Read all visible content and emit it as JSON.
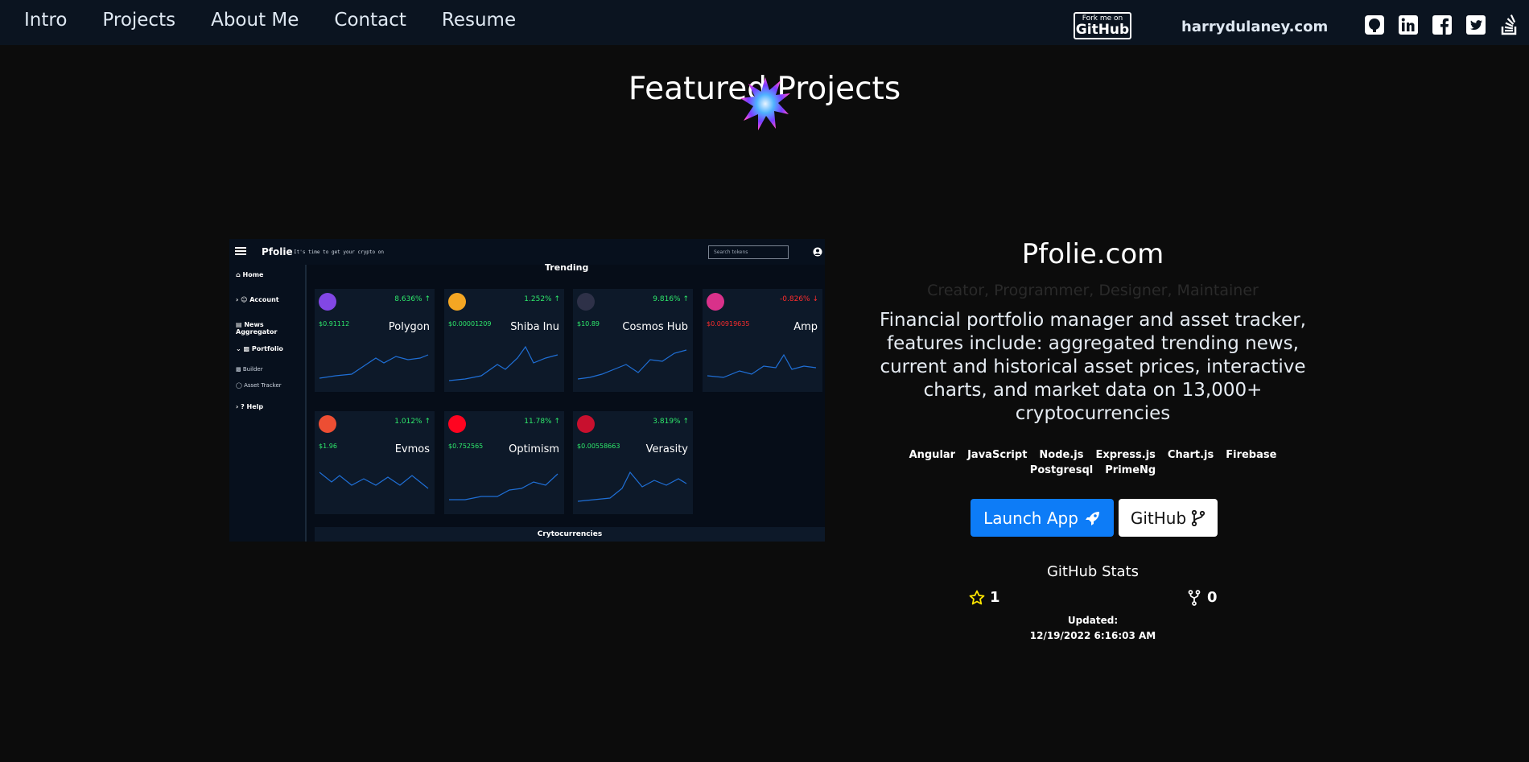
{
  "nav": {
    "links": [
      "Intro",
      "Projects",
      "About Me",
      "Contact",
      "Resume"
    ],
    "fork_small": "Fork me on",
    "fork_big": "GitHub",
    "domain": "harrydulaney.com",
    "socials": [
      "github-icon",
      "linkedin-icon",
      "facebook-icon",
      "twitter-icon",
      "stackoverflow-icon"
    ]
  },
  "page_title": "Featured Projects",
  "preview": {
    "brand": "Pfolie",
    "tagline": "It's time to get your crypto on",
    "search_placeholder": "Search tokens",
    "sidebar": {
      "home": "Home",
      "account": "Account",
      "news": "News Aggregator",
      "portfolio": "Portfolio",
      "builder": "Builder",
      "asset_tracker": "Asset Tracker",
      "help": "Help"
    },
    "trending": "Trending",
    "crypto_heading": "Crytocurrencies",
    "cards": [
      {
        "name": "Polygon",
        "price": "$0.91112",
        "pct": "8.636%",
        "up": true,
        "color": "#8247e5"
      },
      {
        "name": "Shiba Inu",
        "price": "$0.00001209",
        "pct": "1.252%",
        "up": true,
        "color": "#f4a623"
      },
      {
        "name": "Cosmos Hub",
        "price": "$10.89",
        "pct": "9.816%",
        "up": true,
        "color": "#2e3148"
      },
      {
        "name": "Amp",
        "price": "$0.00919635",
        "pct": "-0.826%",
        "up": false,
        "color": "#d9318a"
      },
      {
        "name": "Evmos",
        "price": "$1.96",
        "pct": "1.012%",
        "up": true,
        "color": "#ed4e33"
      },
      {
        "name": "Optimism",
        "price": "$0.752565",
        "pct": "11.78%",
        "up": true,
        "color": "#ff0420"
      },
      {
        "name": "Verasity",
        "price": "$0.00558663",
        "pct": "3.819%",
        "up": true,
        "color": "#c8102e"
      }
    ],
    "colors": {
      "up": "#2ee86b",
      "down": "#ff2d2d",
      "spark": "#1f6fd6"
    }
  },
  "project": {
    "title": "Pfolie.com",
    "roles": "Creator, Programmer, Designer, Maintainer",
    "description": "Financial portfolio manager and asset tracker, features include: aggregated trending news, current and historical asset prices, interactive charts, and market data on 13,000+ cryptocurrencies",
    "tags": [
      "Angular",
      "JavaScript",
      "Node.js",
      "Express.js",
      "Chart.js",
      "Firebase",
      "Postgresql",
      "PrimeNg"
    ],
    "launch_label": "Launch App",
    "github_label": "GitHub",
    "stats_title": "GitHub Stats",
    "stars": "1",
    "forks": "0",
    "updated_label": "Updated:",
    "updated_value": "12/19/2022 6:16:03 AM"
  }
}
